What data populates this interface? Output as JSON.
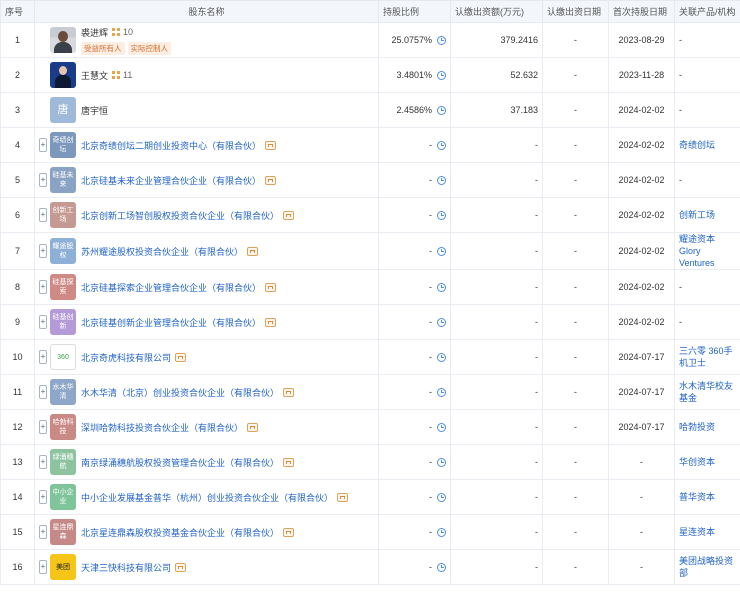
{
  "headers": [
    "序号",
    "股东名称",
    "持股比例",
    "认缴出资额(万元)",
    "认缴出资日期",
    "首次持股日期",
    "关联产品/机构"
  ],
  "rows": [
    {
      "index": "1",
      "name": "裘进辉",
      "type": "person",
      "photo": "photo1",
      "count": "10",
      "tags": [
        "受益所有人",
        "实际控制人"
      ],
      "ratio": "25.0757%",
      "capital": "379.2416",
      "sub_date": "-",
      "first_date": "2023-08-29",
      "related": "-"
    },
    {
      "index": "2",
      "name": "王慧文",
      "type": "person",
      "photo": "photo2",
      "count": "11",
      "tags": [],
      "ratio": "3.4801%",
      "capital": "52.632",
      "sub_date": "-",
      "first_date": "2023-11-28",
      "related": "-"
    },
    {
      "index": "3",
      "name": "唐宇恒",
      "type": "person-char",
      "logo_text": "唐",
      "logo_color": "#9fb9d8",
      "count": "",
      "tags": [],
      "ratio": "2.4586%",
      "capital": "37.183",
      "sub_date": "-",
      "first_date": "2024-02-02",
      "related": "-"
    },
    {
      "index": "4",
      "name": "北京奇绩创坛二期创业投资中心（有限合伙）",
      "type": "company",
      "logo_text": "奇绩创坛",
      "logo_color": "#7c98bd",
      "ratio": "-",
      "capital": "-",
      "sub_date": "-",
      "first_date": "2024-02-02",
      "related": "奇绩创坛"
    },
    {
      "index": "5",
      "name": "北京硅基未来企业管理合伙企业（有限合伙）",
      "type": "company",
      "logo_text": "硅基未来",
      "logo_color": "#8aa2c4",
      "ratio": "-",
      "capital": "-",
      "sub_date": "-",
      "first_date": "2024-02-02",
      "related": "-"
    },
    {
      "index": "6",
      "name": "北京创新工场智创股权投资合伙企业（有限合伙）",
      "type": "company",
      "logo_text": "创新工场",
      "logo_color": "#c49a92",
      "ratio": "-",
      "capital": "-",
      "sub_date": "-",
      "first_date": "2024-02-02",
      "related": "创新工场"
    },
    {
      "index": "7",
      "name": "苏州耀途股权投资合伙企业（有限合伙）",
      "type": "company",
      "logo_text": "耀途股权",
      "logo_color": "#8fb0d6",
      "ratio": "-",
      "capital": "-",
      "sub_date": "-",
      "first_date": "2024-02-02",
      "related": "耀途资本 Glory Ventures"
    },
    {
      "index": "8",
      "name": "北京硅基探索企业管理合伙企业（有限合伙）",
      "type": "company",
      "logo_text": "硅基探索",
      "logo_color": "#cf8a86",
      "ratio": "-",
      "capital": "-",
      "sub_date": "-",
      "first_date": "2024-02-02",
      "related": "-"
    },
    {
      "index": "9",
      "name": "北京硅基创新企业管理合伙企业（有限合伙）",
      "type": "company",
      "logo_text": "硅基创新",
      "logo_color": "#b49ad6",
      "ratio": "-",
      "capital": "-",
      "sub_date": "-",
      "first_date": "2024-02-02",
      "related": "-"
    },
    {
      "index": "10",
      "name": "北京奇虎科技有限公司",
      "type": "company",
      "logo_text": "360",
      "logo_color": "#ffffff",
      "ratio": "-",
      "capital": "-",
      "sub_date": "-",
      "first_date": "2024-07-17",
      "related": "三六零 360手机卫士"
    },
    {
      "index": "11",
      "name": "水木华清（北京）创业投资合伙企业（有限合伙）",
      "type": "company",
      "logo_text": "水木华清",
      "logo_color": "#8ea7c9",
      "ratio": "-",
      "capital": "-",
      "sub_date": "-",
      "first_date": "2024-07-17",
      "related": "水木清华校友基金"
    },
    {
      "index": "12",
      "name": "深圳哈勃科技投资合伙企业（有限合伙）",
      "type": "company",
      "logo_text": "哈勃科技",
      "logo_color": "#c98a86",
      "ratio": "-",
      "capital": "-",
      "sub_date": "-",
      "first_date": "2024-07-17",
      "related": "哈勃投资"
    },
    {
      "index": "13",
      "name": "南京绿涌穗航股权投资管理合伙企业（有限合伙）",
      "type": "company",
      "logo_text": "绿涌穗航",
      "logo_color": "#8ec3a0",
      "ratio": "-",
      "capital": "-",
      "sub_date": "-",
      "first_date": "-",
      "related": "华创资本"
    },
    {
      "index": "14",
      "name": "中小企业发展基金普华（杭州）创业投资合伙企业（有限合伙）",
      "type": "company",
      "logo_text": "中小企业",
      "logo_color": "#7fc49a",
      "ratio": "-",
      "capital": "-",
      "sub_date": "-",
      "first_date": "-",
      "related": "普华资本"
    },
    {
      "index": "15",
      "name": "北京星连鼎森股权投资基金合伙企业（有限合伙）",
      "type": "company",
      "logo_text": "星连鼎森",
      "logo_color": "#c58a88",
      "ratio": "-",
      "capital": "-",
      "sub_date": "-",
      "first_date": "-",
      "related": "星连资本"
    },
    {
      "index": "16",
      "name": "天津三快科技有限公司",
      "type": "company",
      "logo_text": "美团",
      "logo_color": "#f5c518",
      "ratio": "-",
      "capital": "-",
      "sub_date": "-",
      "first_date": "-",
      "related": "美团战略投资部"
    }
  ]
}
